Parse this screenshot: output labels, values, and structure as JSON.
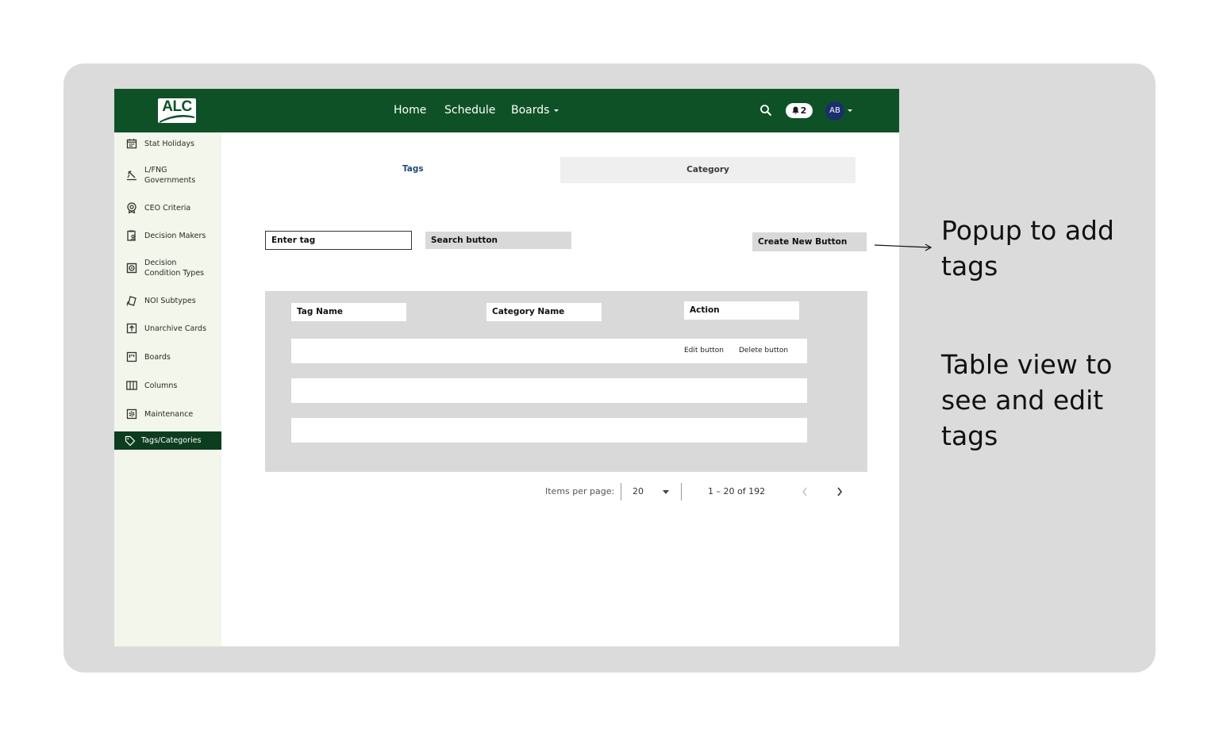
{
  "header": {
    "logo_text": "ALC",
    "nav": [
      "Home",
      "Schedule",
      "Boards"
    ],
    "notification_count": "2",
    "avatar_initials": "AB",
    "brand_color": "#0f5127"
  },
  "sidebar": {
    "items": [
      {
        "label": "Stat Holidays",
        "icon": "calendar-icon"
      },
      {
        "label": "L/FNG\nGovernments",
        "icon": "gavel-icon"
      },
      {
        "label": "CEO Criteria",
        "icon": "badge-icon"
      },
      {
        "label": "Decision Makers",
        "icon": "clipboard-user-icon"
      },
      {
        "label": "Decision\nCondition Types",
        "icon": "condition-icon"
      },
      {
        "label": "NOI Subtypes",
        "icon": "cards-icon"
      },
      {
        "label": "Unarchive Cards",
        "icon": "unarchive-icon"
      },
      {
        "label": "Boards",
        "icon": "board-icon"
      },
      {
        "label": "Columns",
        "icon": "columns-icon"
      },
      {
        "label": "Maintenance",
        "icon": "gear-icon"
      },
      {
        "label": "Tags/Categories",
        "icon": "tag-icon",
        "active": true
      }
    ]
  },
  "tabs": {
    "tags": "Tags",
    "category": "Category"
  },
  "toolbar": {
    "input_value": "Enter tag",
    "search_label": "Search button",
    "create_label": "Create New Button"
  },
  "table": {
    "columns": [
      "Tag Name",
      "Category Name",
      "Action"
    ],
    "row_actions": {
      "edit": "Edit button",
      "delete": "Delete button"
    }
  },
  "pagination": {
    "items_per_page_label": "Items per page:",
    "page_size": "20",
    "range": "1 – 20 of 192"
  },
  "annotations": {
    "popup": "Popup to add\ntags",
    "table": "Table view to\nsee and edit\ntags"
  }
}
